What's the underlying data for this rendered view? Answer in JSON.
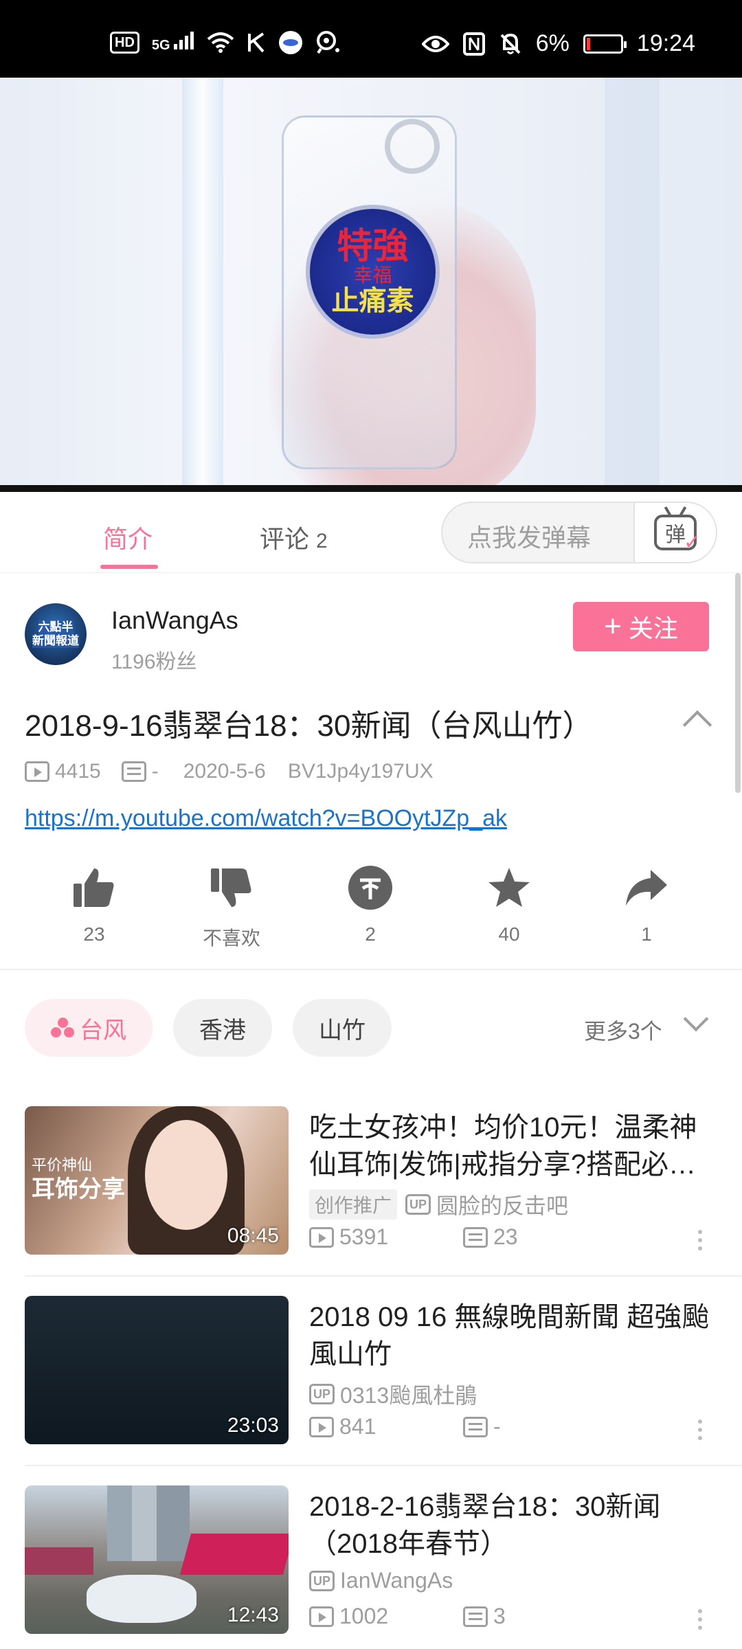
{
  "status_bar": {
    "hd": "HD",
    "network": "5G",
    "battery": "6%",
    "time": "19:24",
    "icons": [
      "hd-icon",
      "signal-icon",
      "wifi-icon",
      "k-app-icon",
      "app-icon",
      "location-icon",
      "eye-icon",
      "nfc-icon",
      "mute-bell-icon",
      "battery-icon"
    ]
  },
  "video": {
    "overlay_text": [
      "特強",
      "幸福",
      "止痛素"
    ]
  },
  "tabs": {
    "intro": "简介",
    "comments": "评论",
    "comments_count": "2",
    "danmaku_placeholder": "点我发弹幕",
    "danmaku_icon_glyph": "弹"
  },
  "uploader": {
    "avatar_text": [
      "六點半",
      "新聞報道"
    ],
    "name": "IanWangAs",
    "fans": "1196粉丝",
    "follow_plus": "+",
    "follow_label": "关注"
  },
  "video_info": {
    "title": "2018-9-16翡翠台18：30新闻（台风山竹）",
    "views": "4415",
    "danmaku_count": "-",
    "date": "2020-5-6",
    "bvid": "BV1Jp4y197UX",
    "link": "https://m.youtube.com/watch?v=BOOytJZp_ak"
  },
  "actions": [
    {
      "name": "like",
      "icon": "thumb-up-icon",
      "count": "23"
    },
    {
      "name": "dislike",
      "icon": "thumb-down-icon",
      "count": "不喜欢"
    },
    {
      "name": "coin",
      "icon": "coin-icon",
      "count": "2"
    },
    {
      "name": "favorite",
      "icon": "star-icon",
      "count": "40"
    },
    {
      "name": "share",
      "icon": "share-icon",
      "count": "1"
    }
  ],
  "tags": {
    "items": [
      "台风",
      "香港",
      "山竹"
    ],
    "more": "更多3个"
  },
  "related": [
    {
      "title": "吃土女孩冲！均价10元！温柔神仙耳饰|发饰|戒指分享?搭配必…",
      "promo": "创作推广",
      "up_badge": "UP",
      "uploader": "圆脸的反击吧",
      "views": "5391",
      "danmaku": "23",
      "duration": "08:45",
      "thumb_text": [
        "平价神仙",
        "耳饰分享"
      ]
    },
    {
      "title": "2018 09 16 無線晚間新聞 超強颱風山竹",
      "up_badge": "UP",
      "uploader": "0313颱風杜鵑",
      "views": "841",
      "danmaku": "-",
      "duration": "23:03"
    },
    {
      "title": "2018-2-16翡翠台18：30新闻（2018年春节）",
      "up_badge": "UP",
      "uploader": "IanWangAs",
      "views": "1002",
      "danmaku": "3",
      "duration": "12:43"
    }
  ],
  "colors": {
    "accent": "#fb7299",
    "link": "#1a73c8",
    "text_primary": "#212121",
    "text_secondary": "#9e9e9e"
  }
}
